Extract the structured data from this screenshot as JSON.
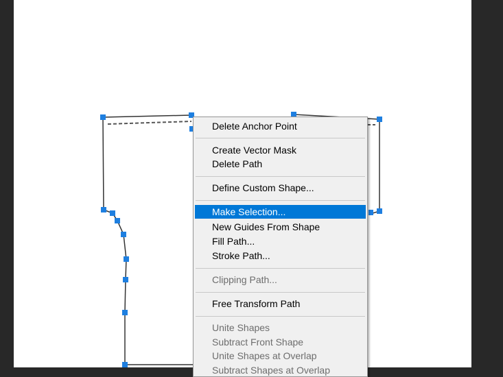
{
  "context_menu": {
    "items": [
      {
        "label": "Delete Anchor Point",
        "enabled": true
      },
      {
        "label": "Create Vector Mask",
        "enabled": true
      },
      {
        "label": "Delete Path",
        "enabled": true
      },
      {
        "label": "Define Custom Shape...",
        "enabled": true
      },
      {
        "label": "Make Selection...",
        "enabled": true,
        "highlighted": true
      },
      {
        "label": "New Guides From Shape",
        "enabled": true
      },
      {
        "label": "Fill Path...",
        "enabled": true
      },
      {
        "label": "Stroke Path...",
        "enabled": true
      },
      {
        "label": "Clipping Path...",
        "enabled": false
      },
      {
        "label": "Free Transform Path",
        "enabled": true
      },
      {
        "label": "Unite Shapes",
        "enabled": false
      },
      {
        "label": "Subtract Front Shape",
        "enabled": false
      },
      {
        "label": "Unite Shapes at Overlap",
        "enabled": false
      },
      {
        "label": "Subtract Shapes at Overlap",
        "enabled": false
      }
    ]
  },
  "colors": {
    "anchor": "#1e7fe0",
    "highlight": "#0078d7",
    "background": "#282828"
  }
}
